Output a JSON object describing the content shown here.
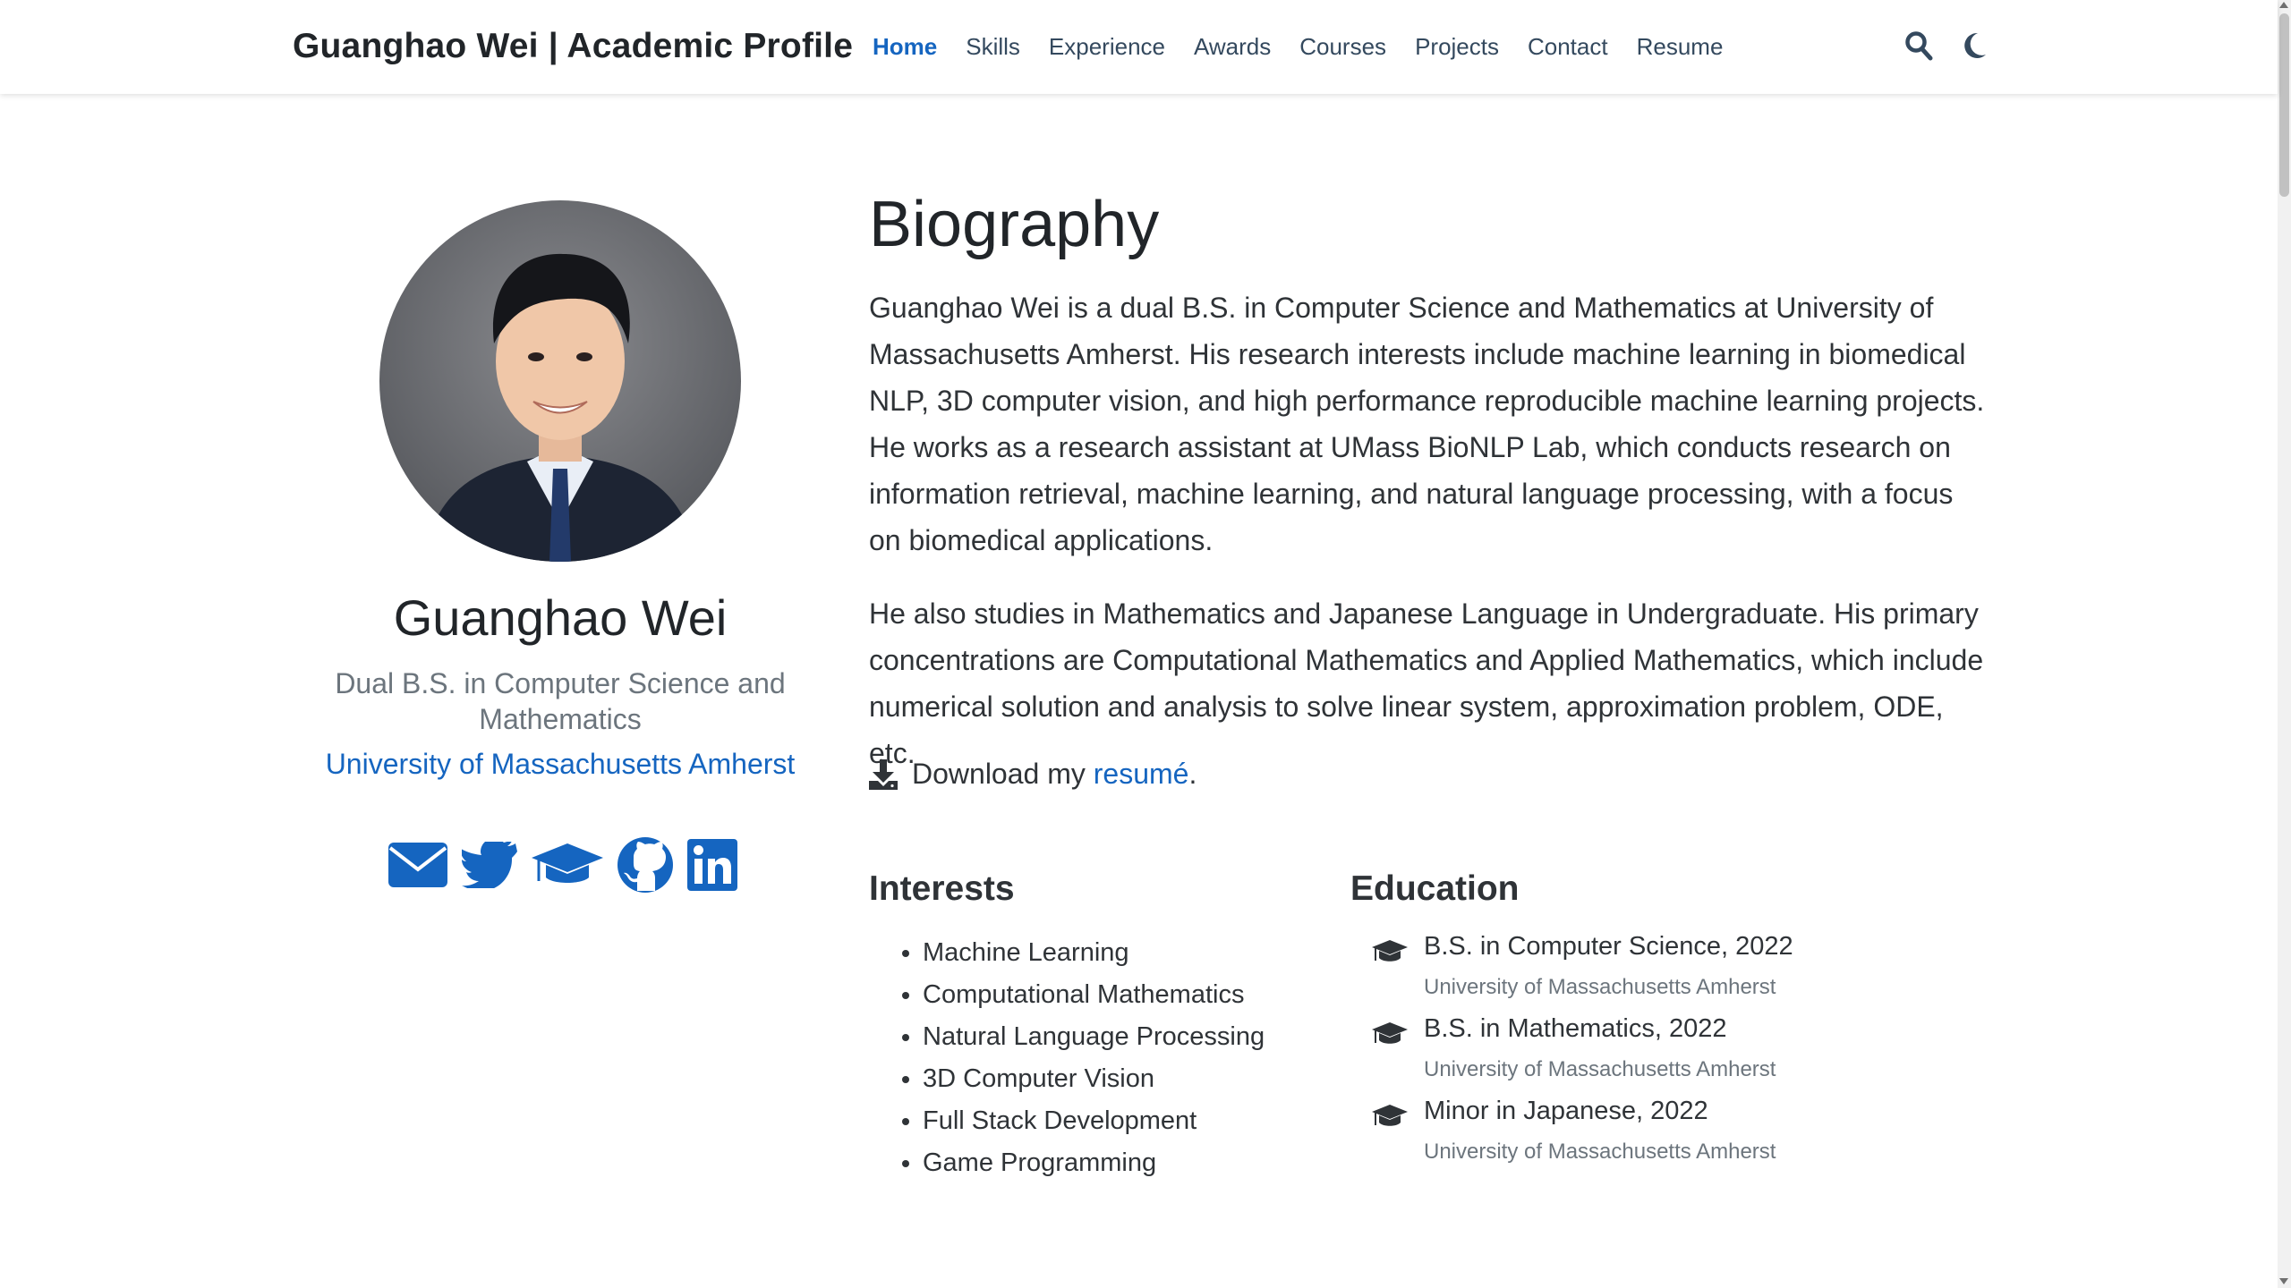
{
  "navbar": {
    "brand": "Guanghao Wei | Academic Profile",
    "links": [
      {
        "label": "Home",
        "active": true
      },
      {
        "label": "Skills"
      },
      {
        "label": "Experience"
      },
      {
        "label": "Awards"
      },
      {
        "label": "Courses"
      },
      {
        "label": "Projects"
      },
      {
        "label": "Contact"
      },
      {
        "label": "Resume"
      }
    ],
    "tools": [
      "search-icon",
      "moon-icon"
    ]
  },
  "profile": {
    "name": "Guanghao Wei",
    "role": "Dual B.S. in Computer Science and Mathematics",
    "organization": "University of Massachusetts Amherst",
    "social": [
      "envelope-icon",
      "twitter-icon",
      "graduation-cap-icon",
      "github-icon",
      "linkedin-icon"
    ]
  },
  "biography": {
    "title": "Biography",
    "paragraphs": [
      "Guanghao Wei is a dual B.S. in Computer Science and Mathematics at University of Massachusetts Amherst. His research interests include machine learning in biomedical NLP, 3D computer vision, and high performance reproducible machine learning projects. He works as a research assistant at UMass BioNLP Lab, which conducts research on information retrieval, machine learning, and natural language processing, with a focus on biomedical applications.",
      "He also studies in Mathematics and Japanese Language in Undergraduate. His primary concentrations are Computational Mathematics and Applied Mathematics, which include numerical solution and analysis to solve linear system, approximation problem, ODE, etc."
    ],
    "download_prefix": "Download my ",
    "download_link": "resumé",
    "download_suffix": "."
  },
  "interests": {
    "title": "Interests",
    "items": [
      "Machine Learning",
      "Computational Mathematics",
      "Natural Language Processing",
      "3D Computer Vision",
      "Full Stack Development",
      "Game Programming"
    ]
  },
  "education": {
    "title": "Education",
    "items": [
      {
        "degree": "B.S. in Computer Science, 2022",
        "school": "University of Massachusetts Amherst"
      },
      {
        "degree": "B.S. in Mathematics, 2022",
        "school": "University of Massachusetts Amherst"
      },
      {
        "degree": "Minor in Japanese, 2022",
        "school": "University of Massachusetts Amherst"
      }
    ]
  },
  "colors": {
    "accent": "#1565c0",
    "text": "#2f3337",
    "muted": "#6c757d"
  }
}
